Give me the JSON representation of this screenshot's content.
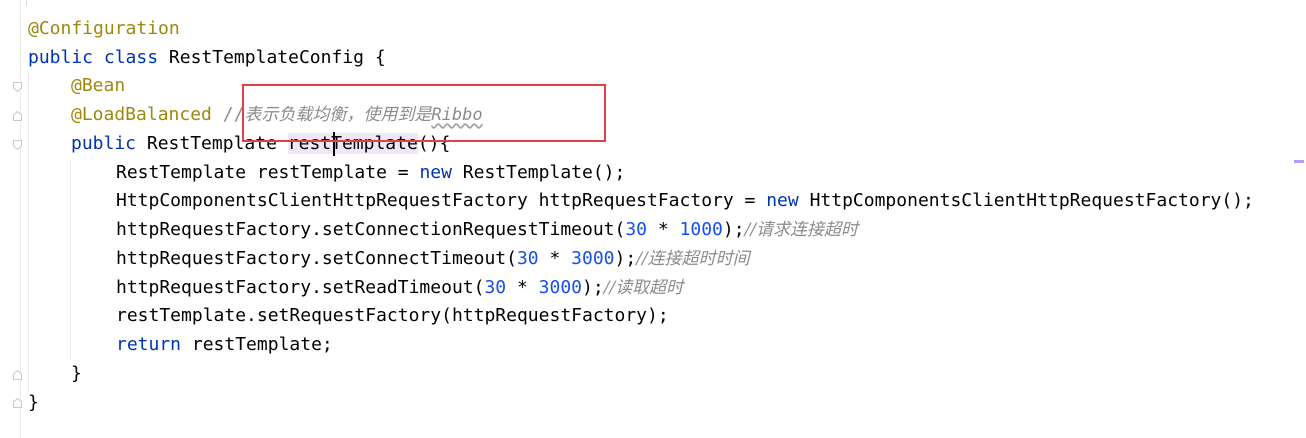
{
  "colors": {
    "keyword": "#0033b3",
    "annotation": "#9e880d",
    "number": "#1750eb",
    "comment": "#8c8c8c",
    "highlight": "#ede7f7",
    "callout_box": "#e2413f"
  },
  "code": {
    "annotation_configuration": "@Configuration",
    "kw_public": "public",
    "kw_class": "class",
    "class_name": "RestTemplateConfig",
    "brace_open": " {",
    "annotation_bean": "@Bean",
    "annotation_load_balanced": "@LoadBalanced",
    "comment_slashes": "//",
    "comment_load_balance": "表示负载均衡，使用到是",
    "comment_ribbo": "Ribbo",
    "return_type": "RestTemplate",
    "method_name": "restTemplate",
    "method_sig_tail": "(){",
    "l5_a": "RestTemplate restTemplate = ",
    "kw_new": "new",
    "l5_b": " RestTemplate();",
    "l6_a": "HttpComponentsClientHttpRequestFactory httpRequestFactory = ",
    "l6_b": " HttpComponentsClientHttpRequestFactory();",
    "l7_a": "httpRequestFactory.setConnectionRequestTimeout(",
    "l7_n1": "30",
    "l7_op": " * ",
    "l7_n2": "1000",
    "l7_close": ");",
    "l7_comment": "//请求连接超时",
    "l8_a": "httpRequestFactory.setConnectTimeout(",
    "l8_n1": "30",
    "l8_op": " * ",
    "l8_n2": "3000",
    "l8_close": ");",
    "l8_comment": "//连接超时时间",
    "l9_a": "httpRequestFactory.setReadTimeout(",
    "l9_n1": "30",
    "l9_op": " * ",
    "l9_n2": "3000",
    "l9_close": ");",
    "l9_comment": "//读取超时",
    "l10": "restTemplate.setRequestFactory(httpRequestFactory);",
    "kw_return": "return",
    "l11_b": " restTemplate;",
    "close_method": "}",
    "close_class": "}"
  }
}
